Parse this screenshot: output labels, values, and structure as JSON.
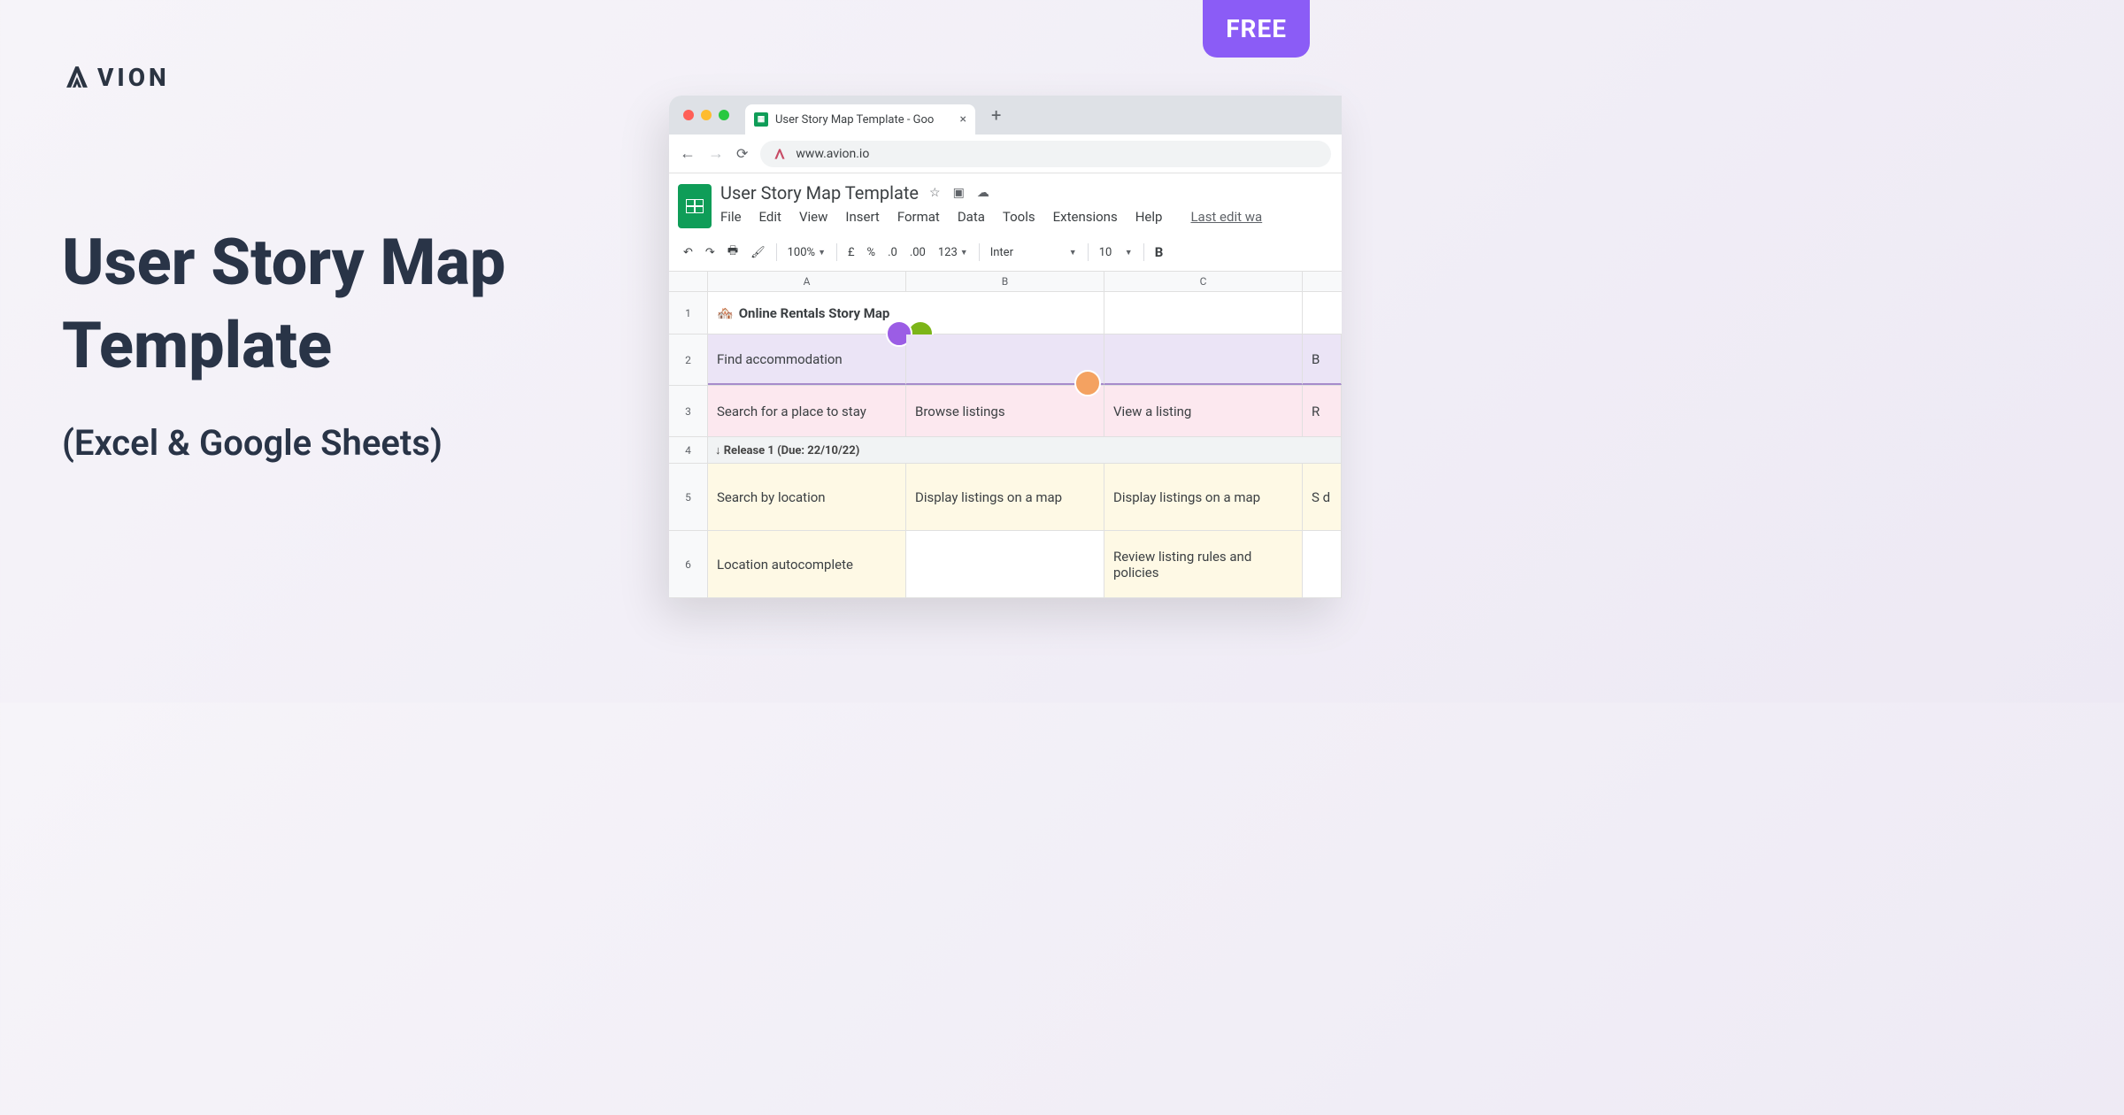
{
  "badge": {
    "text": "FREE"
  },
  "logo": {
    "text": "VION"
  },
  "hero": {
    "title_line1": "User Story Map",
    "title_line2": "Template",
    "subtitle": "(Excel & Google Sheets)"
  },
  "browser": {
    "tab_title": "User Story Map Template - Goo",
    "url": "www.avion.io",
    "new_tab_plus": "+",
    "tab_close": "×"
  },
  "sheets": {
    "doc_title": "User Story Map Template",
    "menu": {
      "file": "File",
      "edit": "Edit",
      "view": "View",
      "insert": "Insert",
      "format": "Format",
      "data": "Data",
      "tools": "Tools",
      "extensions": "Extensions",
      "help": "Help",
      "last_edit": "Last edit wa"
    },
    "toolbar": {
      "zoom": "100%",
      "currency": "£",
      "percent": "%",
      "dec1": ".0",
      "dec2": ".00",
      "numfmt": "123",
      "font": "Inter",
      "size": "10",
      "bold": "B"
    },
    "columns": {
      "a": "A",
      "b": "B",
      "c": "C"
    },
    "rows": {
      "r1": "1",
      "r2": "2",
      "r3": "3",
      "r4": "4",
      "r5": "5",
      "r6": "6"
    },
    "data": {
      "title_emoji": "🏘️",
      "title": "Online Rentals Story Map",
      "goal": "Find accommodation",
      "goal_next": "B",
      "step_a": "Search for a place to stay",
      "step_b": "Browse listings",
      "step_c": "View a listing",
      "step_d": "R",
      "release_label": "↓ Release 1 (Due: 22/10/22)",
      "r5a": "Search by location",
      "r5b": "Display listings on a map",
      "r5c": "Display listings on a map",
      "r5d": "S d",
      "r6a": "Location autocomplete",
      "r6b": "",
      "r6c": "Review listing rules and policies"
    }
  }
}
